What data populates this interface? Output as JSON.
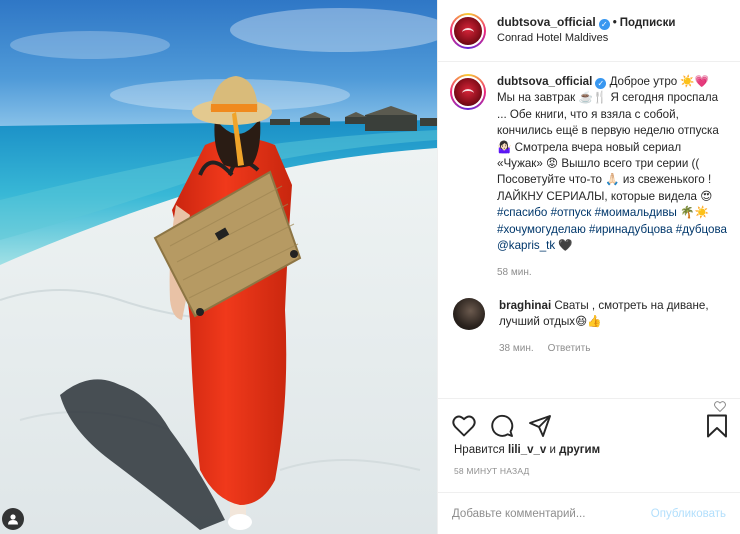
{
  "header": {
    "username": "dubtsova_official",
    "separator": "•",
    "follow_label": "Подписки",
    "location": "Conrad Hotel Maldives"
  },
  "caption": {
    "username": "dubtsova_official",
    "text_1": "Доброе утро ☀️💗 Мы на завтрак ☕️🍴 Я сегодня проспала ... Обе книги, что я взяла с собой, кончились ещё в первую неделю отпуска🤷🏻‍♀️ Смотрела вчера новый сериал «Чужак» 😡 Вышло всего три серии (( Посоветуйте что-то 🙏🏻 из свеженького ! ЛАЙКНУ СЕРИАЛЫ, которые видела 😍 ",
    "hashtags_1": [
      "#спасибо",
      "#отпуск",
      "#моимальдивы"
    ],
    "emoji_mid": "🌴☀️",
    "hashtags_2": [
      "#хочумогуделаю",
      "#иринадубцова",
      "#дубцова"
    ],
    "mention": "@kapris_tk",
    "emoji_end": "🖤",
    "time": "58 мин."
  },
  "comment": {
    "username": "braghinai",
    "text": "Сваты , смотреть на диване, лучший отдых😆👍",
    "time": "38 мин.",
    "reply_label": "Ответить"
  },
  "actions": {
    "like": "heart-icon",
    "comment": "comment-icon",
    "share": "share-icon",
    "save": "bookmark-icon"
  },
  "likes": {
    "prefix": "Нравится ",
    "user": "lili_v_v",
    "middle": " и ",
    "others": "другим"
  },
  "timestamp": "58 МИНУТ НАЗАД",
  "add_comment": {
    "placeholder": "Добавьте комментарий...",
    "publish_label": "Опубликовать"
  },
  "colors": {
    "link": "#00376b",
    "verified": "#3897f0",
    "muted": "#8e8e8e",
    "publish_disabled": "#b2dffc"
  }
}
